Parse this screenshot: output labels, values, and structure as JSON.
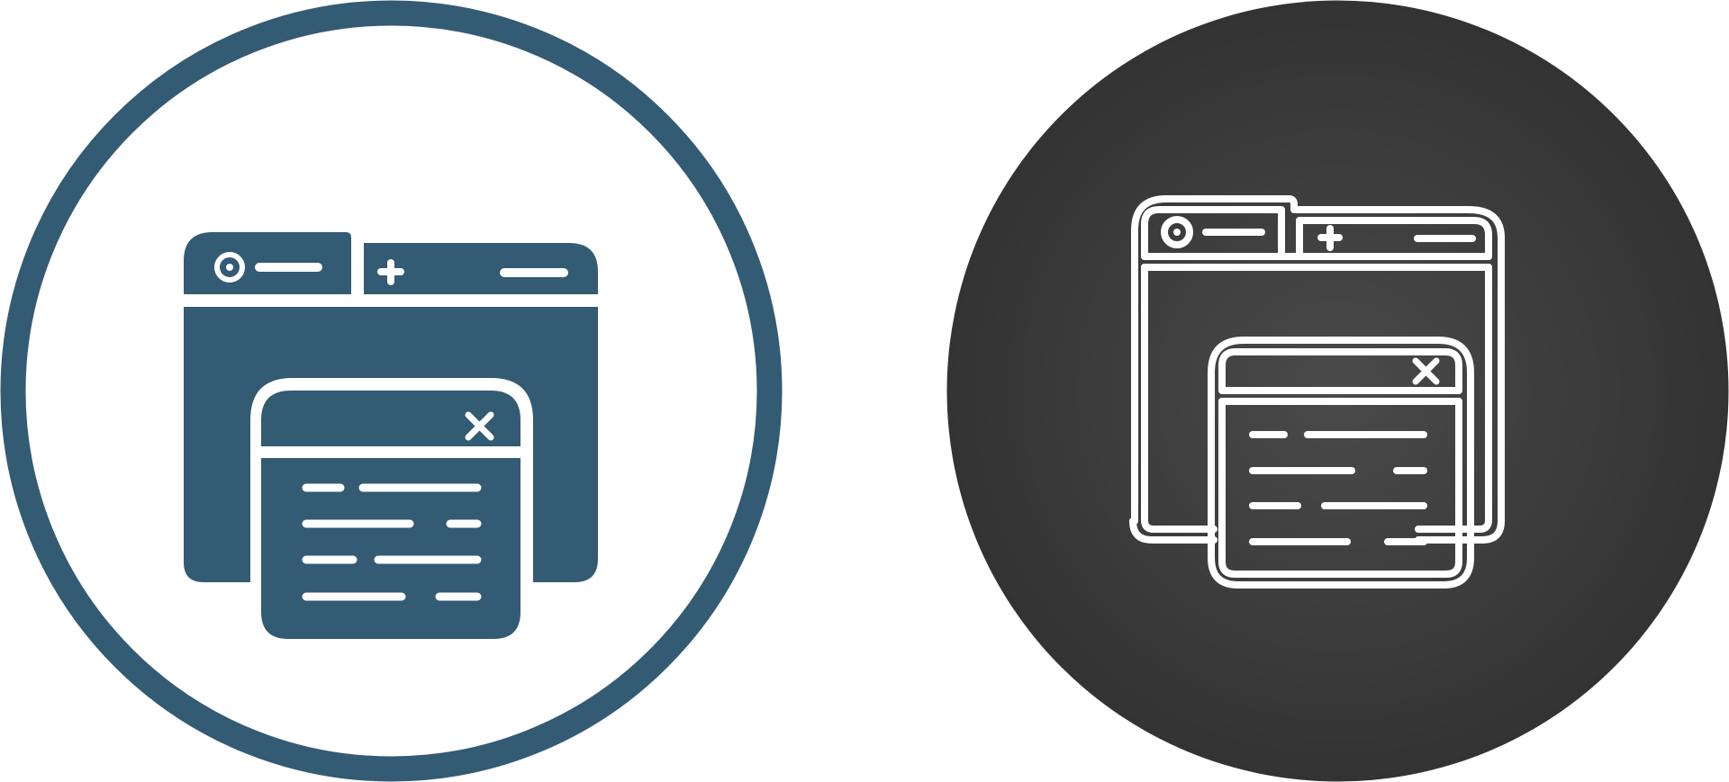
{
  "icons": [
    {
      "name": "browser-windows-glyph-icon",
      "style": "glyph",
      "colors": {
        "ring": "#335b73",
        "fill": "#335b73",
        "background": "#ffffff",
        "detail": "#ffffff"
      }
    },
    {
      "name": "browser-windows-line-icon",
      "style": "line",
      "colors": {
        "circle_center": "#4a4a4a",
        "circle_edge": "#333333",
        "stroke": "#ffffff"
      }
    }
  ]
}
